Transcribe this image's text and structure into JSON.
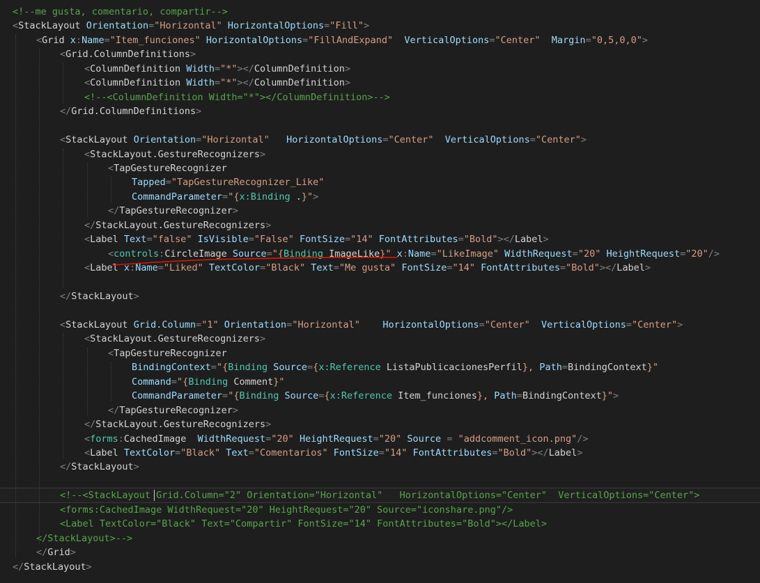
{
  "editor": {
    "lines": [
      [
        [
          "c-cm",
          "<!--me gusta, comentario, compartir-->"
        ]
      ],
      [
        [
          "c-pu",
          "<"
        ],
        [
          "c-el",
          "StackLayout"
        ],
        [
          "c-tx",
          " "
        ],
        [
          "c-at",
          "Orientation"
        ],
        [
          "c-pu",
          "="
        ],
        [
          "c-st",
          "\"Horizontal\""
        ],
        [
          "c-tx",
          " "
        ],
        [
          "c-at",
          "HorizontalOptions"
        ],
        [
          "c-pu",
          "="
        ],
        [
          "c-st",
          "\"Fill\""
        ],
        [
          "c-pu",
          ">"
        ]
      ],
      [
        [
          "c-pu",
          "<"
        ],
        [
          "c-el",
          "Grid"
        ],
        [
          "c-tx",
          " "
        ],
        [
          "c-at",
          "x"
        ],
        [
          "c-pu",
          ":"
        ],
        [
          "c-at",
          "Name"
        ],
        [
          "c-pu",
          "="
        ],
        [
          "c-st",
          "\"Item_funciones\""
        ],
        [
          "c-tx",
          " "
        ],
        [
          "c-at",
          "HorizontalOptions"
        ],
        [
          "c-pu",
          "="
        ],
        [
          "c-st",
          "\"FillAndExpand\""
        ],
        [
          "c-tx",
          "  "
        ],
        [
          "c-at",
          "VerticalOptions"
        ],
        [
          "c-pu",
          "="
        ],
        [
          "c-st",
          "\"Center\""
        ],
        [
          "c-tx",
          "  "
        ],
        [
          "c-at",
          "Margin"
        ],
        [
          "c-pu",
          "="
        ],
        [
          "c-st",
          "\"0,5,0,0\""
        ],
        [
          "c-pu",
          ">"
        ]
      ],
      [
        [
          "c-pu",
          "<"
        ],
        [
          "c-el",
          "Grid.ColumnDefinitions"
        ],
        [
          "c-pu",
          ">"
        ]
      ],
      [
        [
          "c-pu",
          "<"
        ],
        [
          "c-el",
          "ColumnDefinition"
        ],
        [
          "c-tx",
          " "
        ],
        [
          "c-at",
          "Width"
        ],
        [
          "c-pu",
          "="
        ],
        [
          "c-st",
          "\"*\""
        ],
        [
          "c-pu",
          "></"
        ],
        [
          "c-el",
          "ColumnDefinition"
        ],
        [
          "c-pu",
          ">"
        ]
      ],
      [
        [
          "c-pu",
          "<"
        ],
        [
          "c-el",
          "ColumnDefinition"
        ],
        [
          "c-tx",
          " "
        ],
        [
          "c-at",
          "Width"
        ],
        [
          "c-pu",
          "="
        ],
        [
          "c-st",
          "\"*\""
        ],
        [
          "c-pu",
          "></"
        ],
        [
          "c-el",
          "ColumnDefinition"
        ],
        [
          "c-pu",
          ">"
        ]
      ],
      [
        [
          "c-cm",
          "<!--<ColumnDefinition Width=\"*\"></ColumnDefinition>-->"
        ]
      ],
      [
        [
          "c-pu",
          "</"
        ],
        [
          "c-el",
          "Grid.ColumnDefinitions"
        ],
        [
          "c-pu",
          ">"
        ]
      ],
      [],
      [
        [
          "c-pu",
          "<"
        ],
        [
          "c-el",
          "StackLayout"
        ],
        [
          "c-tx",
          " "
        ],
        [
          "c-at",
          "Orientation"
        ],
        [
          "c-pu",
          "="
        ],
        [
          "c-st",
          "\"Horizontal\""
        ],
        [
          "c-tx",
          "   "
        ],
        [
          "c-at",
          "HorizontalOptions"
        ],
        [
          "c-pu",
          "="
        ],
        [
          "c-st",
          "\"Center\""
        ],
        [
          "c-tx",
          "  "
        ],
        [
          "c-at",
          "VerticalOptions"
        ],
        [
          "c-pu",
          "="
        ],
        [
          "c-st",
          "\"Center\""
        ],
        [
          "c-pu",
          ">"
        ]
      ],
      [
        [
          "c-pu",
          "<"
        ],
        [
          "c-el",
          "StackLayout.GestureRecognizers"
        ],
        [
          "c-pu",
          ">"
        ]
      ],
      [
        [
          "c-pu",
          "<"
        ],
        [
          "c-el",
          "TapGestureRecognizer"
        ]
      ],
      [
        [
          "c-at",
          "Tapped"
        ],
        [
          "c-pu",
          "="
        ],
        [
          "c-st",
          "\"TapGestureRecognizer_Like\""
        ]
      ],
      [
        [
          "c-at",
          "CommandParameter"
        ],
        [
          "c-pu",
          "="
        ],
        [
          "c-st",
          "\"{"
        ],
        [
          "c-ma",
          "x:Binding"
        ],
        [
          "c-ml",
          " ."
        ],
        [
          "c-st",
          "}\""
        ],
        [
          "c-pu",
          ">"
        ]
      ],
      [
        [
          "c-pu",
          "</"
        ],
        [
          "c-el",
          "TapGestureRecognizer"
        ],
        [
          "c-pu",
          ">"
        ]
      ],
      [
        [
          "c-pu",
          "</"
        ],
        [
          "c-el",
          "StackLayout.GestureRecognizers"
        ],
        [
          "c-pu",
          ">"
        ]
      ],
      [
        [
          "c-pu",
          "<"
        ],
        [
          "c-el",
          "Label"
        ],
        [
          "c-tx",
          " "
        ],
        [
          "c-at",
          "Text"
        ],
        [
          "c-pu",
          "="
        ],
        [
          "c-st",
          "\"false\""
        ],
        [
          "c-tx",
          " "
        ],
        [
          "c-at",
          "IsVisible"
        ],
        [
          "c-pu",
          "="
        ],
        [
          "c-st",
          "\"False\""
        ],
        [
          "c-tx",
          " "
        ],
        [
          "c-at",
          "FontSize"
        ],
        [
          "c-pu",
          "="
        ],
        [
          "c-st",
          "\"14\""
        ],
        [
          "c-tx",
          " "
        ],
        [
          "c-at",
          "FontAttributes"
        ],
        [
          "c-pu",
          "="
        ],
        [
          "c-st",
          "\"Bold\""
        ],
        [
          "c-pu",
          "></"
        ],
        [
          "c-el",
          "Label"
        ],
        [
          "c-pu",
          ">"
        ]
      ],
      [
        [
          "c-pu",
          "<"
        ],
        [
          "c-ns",
          "controls"
        ],
        [
          "c-pu",
          ":"
        ],
        [
          "c-el",
          "CircleImage"
        ],
        [
          "c-tx",
          " "
        ],
        [
          "c-at",
          "Source"
        ],
        [
          "c-pu",
          "="
        ],
        [
          "c-st",
          "\"{"
        ],
        [
          "c-ma",
          "Binding"
        ],
        [
          "c-ml",
          " ImageLike"
        ],
        [
          "c-st",
          "}\""
        ],
        [
          "c-tx",
          " "
        ],
        [
          "c-at",
          "x"
        ],
        [
          "c-pu",
          ":"
        ],
        [
          "c-at",
          "Name"
        ],
        [
          "c-pu",
          "="
        ],
        [
          "c-st",
          "\"LikeImage\""
        ],
        [
          "c-tx",
          " "
        ],
        [
          "c-at",
          "WidthRequest"
        ],
        [
          "c-pu",
          "="
        ],
        [
          "c-st",
          "\"20\""
        ],
        [
          "c-tx",
          " "
        ],
        [
          "c-at",
          "HeightRequest"
        ],
        [
          "c-pu",
          "="
        ],
        [
          "c-st",
          "\"20\""
        ],
        [
          "c-pu",
          "/>"
        ]
      ],
      [
        [
          "c-pu",
          "<"
        ],
        [
          "c-el",
          "Label"
        ],
        [
          "c-tx",
          " "
        ],
        [
          "c-at",
          "x"
        ],
        [
          "c-pu",
          ":"
        ],
        [
          "c-at",
          "Name"
        ],
        [
          "c-pu",
          "="
        ],
        [
          "c-st",
          "\"Liked\""
        ],
        [
          "c-tx",
          " "
        ],
        [
          "c-at",
          "TextColor"
        ],
        [
          "c-pu",
          "="
        ],
        [
          "c-st",
          "\"Black\""
        ],
        [
          "c-tx",
          " "
        ],
        [
          "c-at",
          "Text"
        ],
        [
          "c-pu",
          "="
        ],
        [
          "c-st",
          "\"Me gusta\""
        ],
        [
          "c-tx",
          " "
        ],
        [
          "c-at",
          "FontSize"
        ],
        [
          "c-pu",
          "="
        ],
        [
          "c-st",
          "\"14\""
        ],
        [
          "c-tx",
          " "
        ],
        [
          "c-at",
          "FontAttributes"
        ],
        [
          "c-pu",
          "="
        ],
        [
          "c-st",
          "\"Bold\""
        ],
        [
          "c-pu",
          "></"
        ],
        [
          "c-el",
          "Label"
        ],
        [
          "c-pu",
          ">"
        ]
      ],
      [],
      [
        [
          "c-pu",
          "</"
        ],
        [
          "c-el",
          "StackLayout"
        ],
        [
          "c-pu",
          ">"
        ]
      ],
      [],
      [
        [
          "c-pu",
          "<"
        ],
        [
          "c-el",
          "StackLayout"
        ],
        [
          "c-tx",
          " "
        ],
        [
          "c-at",
          "Grid.Column"
        ],
        [
          "c-pu",
          "="
        ],
        [
          "c-st",
          "\"1\""
        ],
        [
          "c-tx",
          " "
        ],
        [
          "c-at",
          "Orientation"
        ],
        [
          "c-pu",
          "="
        ],
        [
          "c-st",
          "\"Horizontal\""
        ],
        [
          "c-tx",
          "    "
        ],
        [
          "c-at",
          "HorizontalOptions"
        ],
        [
          "c-pu",
          "="
        ],
        [
          "c-st",
          "\"Center\""
        ],
        [
          "c-tx",
          "  "
        ],
        [
          "c-at",
          "VerticalOptions"
        ],
        [
          "c-pu",
          "="
        ],
        [
          "c-st",
          "\"Center\""
        ],
        [
          "c-pu",
          ">"
        ]
      ],
      [
        [
          "c-pu",
          "<"
        ],
        [
          "c-el",
          "StackLayout.GestureRecognizers"
        ],
        [
          "c-pu",
          ">"
        ]
      ],
      [
        [
          "c-pu",
          "<"
        ],
        [
          "c-el",
          "TapGestureRecognizer"
        ]
      ],
      [
        [
          "c-at",
          "BindingContext"
        ],
        [
          "c-pu",
          "="
        ],
        [
          "c-st",
          "\"{"
        ],
        [
          "c-ma",
          "Binding"
        ],
        [
          "c-tx",
          " "
        ],
        [
          "c-at",
          "Source"
        ],
        [
          "c-pu",
          "="
        ],
        [
          "c-st",
          "{"
        ],
        [
          "c-ma",
          "x:Reference"
        ],
        [
          "c-ml",
          " ListaPublicacionesPerfil"
        ],
        [
          "c-st",
          "},"
        ],
        [
          "c-tx",
          " "
        ],
        [
          "c-at",
          "Path"
        ],
        [
          "c-pu",
          "="
        ],
        [
          "c-ml",
          "BindingContext"
        ],
        [
          "c-st",
          "}\""
        ]
      ],
      [
        [
          "c-at",
          "Command"
        ],
        [
          "c-pu",
          "="
        ],
        [
          "c-st",
          "\"{"
        ],
        [
          "c-ma",
          "Binding"
        ],
        [
          "c-ml",
          " Comment"
        ],
        [
          "c-st",
          "}\""
        ]
      ],
      [
        [
          "c-at",
          "CommandParameter"
        ],
        [
          "c-pu",
          "="
        ],
        [
          "c-st",
          "\"{"
        ],
        [
          "c-ma",
          "Binding"
        ],
        [
          "c-tx",
          " "
        ],
        [
          "c-at",
          "Source"
        ],
        [
          "c-pu",
          "="
        ],
        [
          "c-st",
          "{"
        ],
        [
          "c-ma",
          "x:Reference"
        ],
        [
          "c-ml",
          " Item_funciones"
        ],
        [
          "c-st",
          "},"
        ],
        [
          "c-tx",
          " "
        ],
        [
          "c-at",
          "Path"
        ],
        [
          "c-pu",
          "="
        ],
        [
          "c-ml",
          "BindingContext"
        ],
        [
          "c-st",
          "}\""
        ],
        [
          "c-pu",
          ">"
        ]
      ],
      [
        [
          "c-pu",
          "</"
        ],
        [
          "c-el",
          "TapGestureRecognizer"
        ],
        [
          "c-pu",
          ">"
        ]
      ],
      [
        [
          "c-pu",
          "</"
        ],
        [
          "c-el",
          "StackLayout.GestureRecognizers"
        ],
        [
          "c-pu",
          ">"
        ]
      ],
      [
        [
          "c-pu",
          "<"
        ],
        [
          "c-ns",
          "forms"
        ],
        [
          "c-pu",
          ":"
        ],
        [
          "c-el",
          "CachedImage"
        ],
        [
          "c-tx",
          "  "
        ],
        [
          "c-at",
          "WidthRequest"
        ],
        [
          "c-pu",
          "="
        ],
        [
          "c-st",
          "\"20\""
        ],
        [
          "c-tx",
          " "
        ],
        [
          "c-at",
          "HeightRequest"
        ],
        [
          "c-pu",
          "="
        ],
        [
          "c-st",
          "\"20\""
        ],
        [
          "c-tx",
          " "
        ],
        [
          "c-at",
          "Source"
        ],
        [
          "c-tx",
          " "
        ],
        [
          "c-pu",
          "="
        ],
        [
          "c-tx",
          " "
        ],
        [
          "c-st",
          "\"addcomment_icon.png\""
        ],
        [
          "c-pu",
          "/>"
        ]
      ],
      [
        [
          "c-pu",
          "<"
        ],
        [
          "c-el",
          "Label"
        ],
        [
          "c-tx",
          " "
        ],
        [
          "c-at",
          "TextColor"
        ],
        [
          "c-pu",
          "="
        ],
        [
          "c-st",
          "\"Black\""
        ],
        [
          "c-tx",
          " "
        ],
        [
          "c-at",
          "Text"
        ],
        [
          "c-pu",
          "="
        ],
        [
          "c-st",
          "\"Comentarios\""
        ],
        [
          "c-tx",
          " "
        ],
        [
          "c-at",
          "FontSize"
        ],
        [
          "c-pu",
          "="
        ],
        [
          "c-st",
          "\"14\""
        ],
        [
          "c-tx",
          " "
        ],
        [
          "c-at",
          "FontAttributes"
        ],
        [
          "c-pu",
          "="
        ],
        [
          "c-st",
          "\"Bold\""
        ],
        [
          "c-pu",
          "></"
        ],
        [
          "c-el",
          "Label"
        ],
        [
          "c-pu",
          ">"
        ]
      ],
      [
        [
          "c-pu",
          "</"
        ],
        [
          "c-el",
          "StackLayout"
        ],
        [
          "c-pu",
          ">"
        ]
      ],
      [],
      [
        [
          "c-cm",
          "<!--<StackLayout Grid.Column=\"2\" Orientation=\"Horizontal\"   HorizontalOptions=\"Center\"  VerticalOptions=\"Center\">"
        ]
      ],
      [
        [
          "c-cm",
          "<forms:CachedImage WidthRequest=\"20\" HeightRequest=\"20\" Source=\"iconshare.png\"/>"
        ]
      ],
      [
        [
          "c-cm",
          "<Label TextColor=\"Black\" Text=\"Compartir\" FontSize=\"14\" FontAttributes=\"Bold\"></Label>"
        ]
      ],
      [
        [
          "c-cm",
          "</StackLayout>-->"
        ]
      ],
      [
        [
          "c-pu",
          "</"
        ],
        [
          "c-el",
          "Grid"
        ],
        [
          "c-pu",
          ">"
        ]
      ],
      [
        [
          "c-pu",
          "</"
        ],
        [
          "c-el",
          "StackLayout"
        ],
        [
          "c-pu",
          ">"
        ]
      ]
    ],
    "colors": {
      "background": "#1e1e1e",
      "comment": "#57a64a",
      "punctuation": "#808080",
      "element": "#d4d4d4",
      "namespace": "#4ec9b0",
      "attribute": "#9cdcfe",
      "string": "#d69d85",
      "squiggle": "#e51400"
    }
  }
}
